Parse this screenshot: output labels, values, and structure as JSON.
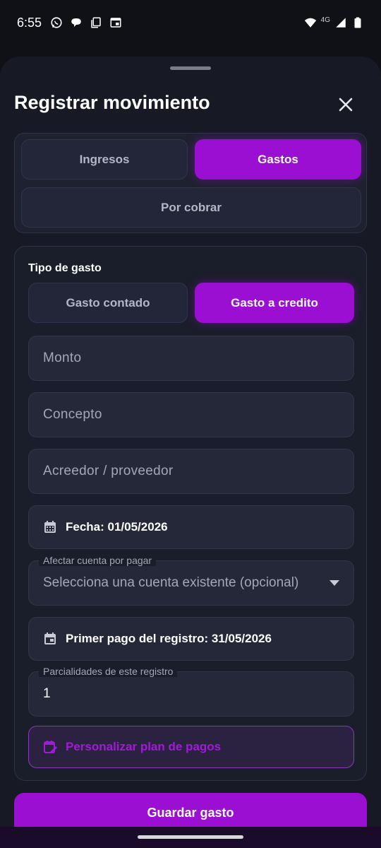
{
  "status_bar": {
    "time": "6:55",
    "network_label": "4G",
    "left_icons": [
      "whatsapp-icon",
      "chat-bubble-icon",
      "copy-icon",
      "calendar-app-icon"
    ],
    "right_icons": [
      "wifi-icon",
      "signal-icon",
      "battery-icon"
    ]
  },
  "sheet": {
    "title": "Registrar movimiento",
    "close_icon": "close-icon"
  },
  "movement_types": {
    "tabs": [
      {
        "label": "Ingresos",
        "active": false
      },
      {
        "label": "Gastos",
        "active": true
      },
      {
        "label": "Por cobrar",
        "active": false
      }
    ]
  },
  "form": {
    "expense_type_label": "Tipo de gasto",
    "expense_types": [
      {
        "label": "Gasto contado",
        "active": false
      },
      {
        "label": "Gasto a credito",
        "active": true
      }
    ],
    "amount_placeholder": "Monto",
    "concept_placeholder": "Concepto",
    "creditor_placeholder": "Acreedor / proveedor",
    "date_text": "Fecha: 01/05/2026",
    "payable_account": {
      "label": "Afectar cuenta por pagar",
      "value": "Selecciona una cuenta existente (opcional)"
    },
    "first_payment_text": "Primer pago del registro: 31/05/2026",
    "installments": {
      "label": "Parcialidades de este registro",
      "value": "1"
    },
    "customize_plan_label": "Personalizar plan de pagos"
  },
  "save_button_label": "Guardar gasto",
  "colors": {
    "accent": "#9a0fd1",
    "background": "#0f1117",
    "sheet": "#171a25",
    "field": "#252838"
  }
}
